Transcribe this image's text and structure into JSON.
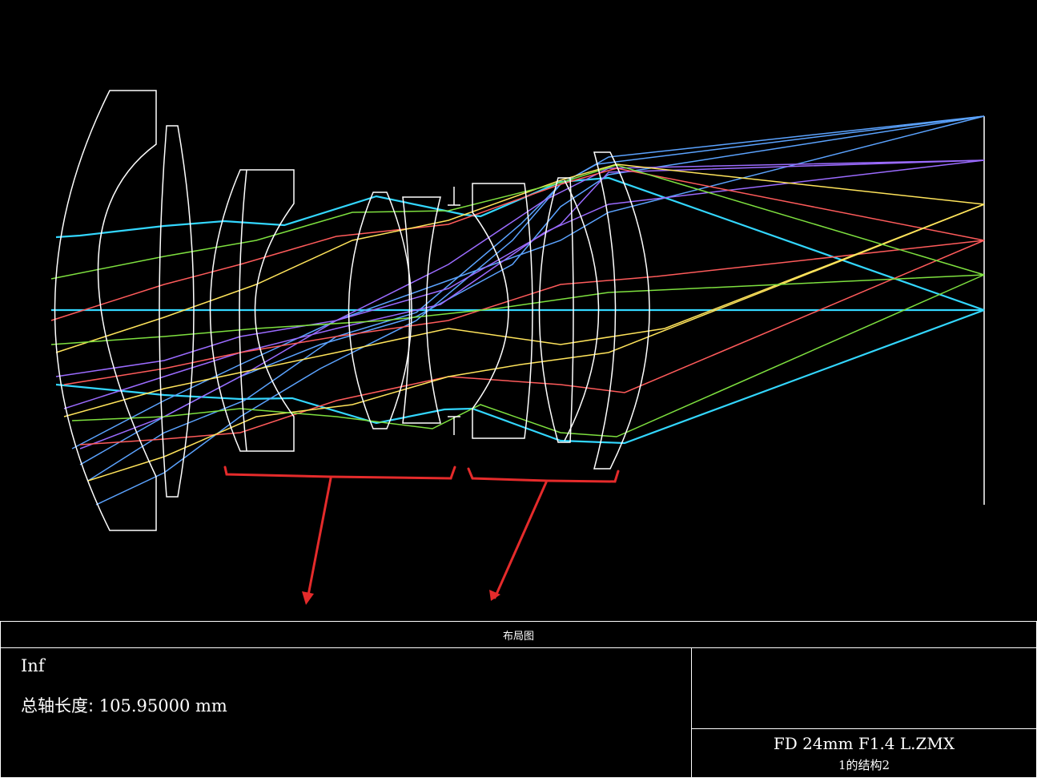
{
  "panel": {
    "title": "布局图",
    "object_distance": "Inf",
    "total_axis_label": "总轴长度:",
    "total_axis_value": "105.95000 mm",
    "file_name": "FD 24mm F1.4 L.ZMX",
    "config_label": "1的结构2"
  },
  "colors": {
    "lens": "#ffffff",
    "axis": "#3fd7ff",
    "annotation": "#e52b2b",
    "ray_fields": [
      "#33d7ff",
      "#5ba3ff",
      "#9b6bff",
      "#ff5b5b",
      "#ffe45b",
      "#7ee03f"
    ]
  }
}
